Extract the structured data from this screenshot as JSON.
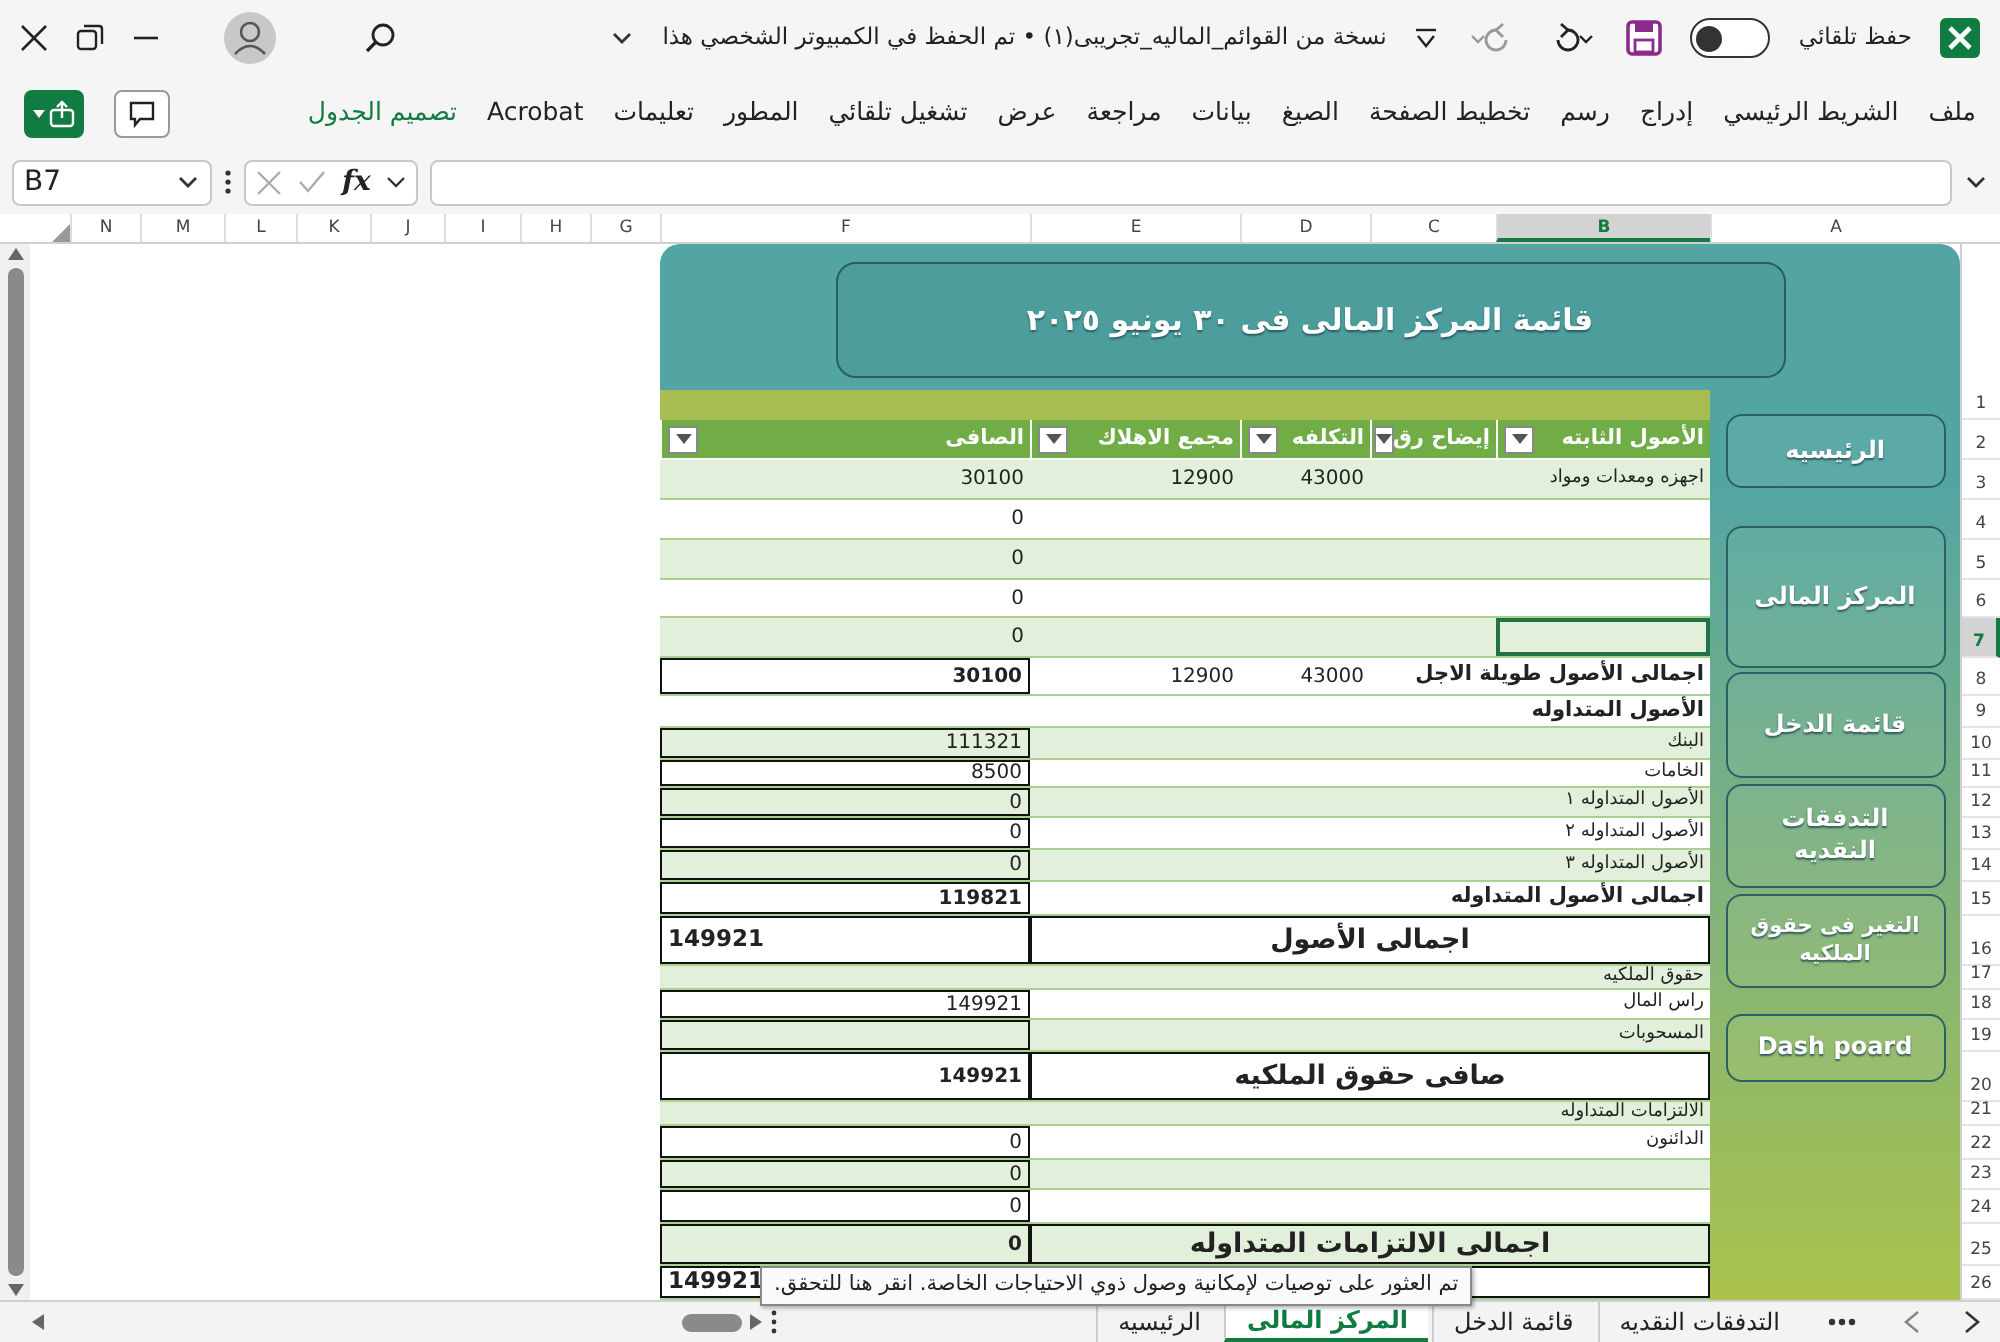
{
  "title_bar": {
    "autosave_label": "حفظ تلقائي",
    "autosave_on": false,
    "document_title": "نسخة من القوائم_الماليه_تجريبى(١) • تم الحفظ في الكمبيوتر الشخصي هذا"
  },
  "ribbon_tabs": [
    {
      "label": "ملف",
      "kind": "tab"
    },
    {
      "label": "الشريط الرئيسي",
      "kind": "tab"
    },
    {
      "label": "إدراج",
      "kind": "tab"
    },
    {
      "label": "رسم",
      "kind": "tab"
    },
    {
      "label": "تخطيط الصفحة",
      "kind": "tab"
    },
    {
      "label": "الصيغ",
      "kind": "tab"
    },
    {
      "label": "بيانات",
      "kind": "tab"
    },
    {
      "label": "مراجعة",
      "kind": "tab"
    },
    {
      "label": "عرض",
      "kind": "tab"
    },
    {
      "label": "تشغيل تلقائي",
      "kind": "tab"
    },
    {
      "label": "المطور",
      "kind": "tab"
    },
    {
      "label": "تعليمات",
      "kind": "tab"
    },
    {
      "label": "Acrobat",
      "kind": "tab"
    },
    {
      "label": "تصميم الجدول",
      "kind": "contextual"
    }
  ],
  "formula_bar": {
    "name_box": "B7",
    "function_label": "fx"
  },
  "column_headers": [
    {
      "label": "A",
      "selected": false
    },
    {
      "label": "B",
      "selected": true
    },
    {
      "label": "C",
      "selected": false
    },
    {
      "label": "D",
      "selected": false
    },
    {
      "label": "E",
      "selected": false
    },
    {
      "label": "F",
      "selected": false
    },
    {
      "label": "G",
      "selected": false
    },
    {
      "label": "H",
      "selected": false
    },
    {
      "label": "I",
      "selected": false
    },
    {
      "label": "J",
      "selected": false
    },
    {
      "label": "K",
      "selected": false
    },
    {
      "label": "L",
      "selected": false
    },
    {
      "label": "M",
      "selected": false
    },
    {
      "label": "N",
      "selected": false
    }
  ],
  "row_headers": [
    {
      "label": "1",
      "selected": false
    },
    {
      "label": "2",
      "selected": false
    },
    {
      "label": "3",
      "selected": false
    },
    {
      "label": "4",
      "selected": false
    },
    {
      "label": "5",
      "selected": false
    },
    {
      "label": "6",
      "selected": false
    },
    {
      "label": "7",
      "selected": true
    },
    {
      "label": "8",
      "selected": false
    },
    {
      "label": "9",
      "selected": false
    },
    {
      "label": "10",
      "selected": false
    },
    {
      "label": "11",
      "selected": false
    },
    {
      "label": "12",
      "selected": false
    },
    {
      "label": "13",
      "selected": false
    },
    {
      "label": "14",
      "selected": false
    },
    {
      "label": "15",
      "selected": false
    },
    {
      "label": "16",
      "selected": false
    },
    {
      "label": "17",
      "selected": false
    },
    {
      "label": "18",
      "selected": false
    },
    {
      "label": "19",
      "selected": false
    },
    {
      "label": "20",
      "selected": false
    },
    {
      "label": "21",
      "selected": false
    },
    {
      "label": "22",
      "selected": false
    },
    {
      "label": "23",
      "selected": false
    },
    {
      "label": "24",
      "selected": false
    },
    {
      "label": "25",
      "selected": false
    },
    {
      "label": "26",
      "selected": false
    }
  ],
  "sheet": {
    "title": "قائمة المركز المالى فى ٣٠ يونيو ٢٠٢٥",
    "table": {
      "columns": [
        "الأصول الثابته",
        "إيضاح رق",
        "التكلفه",
        "مجمع الاهلاك",
        "الصافى"
      ],
      "rows": [
        {
          "kind": "item",
          "label": "اجهزه ومعدات ومواد",
          "cost": "43000",
          "depreciation": "12900",
          "net": "30100",
          "shaded": true,
          "boxed": false,
          "selected": false
        },
        {
          "kind": "item",
          "net": "0",
          "shaded": false,
          "boxed": false,
          "selected": false
        },
        {
          "kind": "item",
          "net": "0",
          "shaded": true,
          "boxed": false,
          "selected": false
        },
        {
          "kind": "item",
          "net": "0",
          "shaded": false,
          "boxed": false,
          "selected": false
        },
        {
          "kind": "item",
          "net": "0",
          "shaded": true,
          "boxed": false,
          "selected": true
        },
        {
          "kind": "total",
          "label": "اجمالى الأصول طويلة الاجل",
          "cost": "43000",
          "depreciation": "12900",
          "net": "30100",
          "shaded": false,
          "boxed": true,
          "selected": false
        },
        {
          "kind": "section",
          "label": "الأصول المتداوله",
          "shaded": false,
          "boxed": false,
          "selected": false
        },
        {
          "kind": "item",
          "label": "البنك",
          "net": "111321",
          "shaded": true,
          "boxed": true,
          "selected": false
        },
        {
          "kind": "item",
          "label": "الخامات",
          "net": "8500",
          "shaded": false,
          "boxed": true,
          "selected": false
        },
        {
          "kind": "item",
          "label": "الأصول المتداوله ١",
          "net": "0",
          "shaded": true,
          "boxed": true,
          "selected": false
        },
        {
          "kind": "item",
          "label": "الأصول المتداوله ٢",
          "net": "0",
          "shaded": false,
          "boxed": true,
          "selected": false
        },
        {
          "kind": "item",
          "label": "الأصول المتداوله ٣",
          "net": "0",
          "shaded": true,
          "boxed": true,
          "selected": false
        },
        {
          "kind": "total",
          "label": "اجمالى الأصول المتداوله",
          "net": "119821",
          "shaded": false,
          "boxed": true,
          "selected": false
        },
        {
          "kind": "grand_total",
          "label": "اجمالى الأصول",
          "net": "149921",
          "shaded": false,
          "boxed": true,
          "selected": false
        },
        {
          "kind": "item",
          "label": "حقوق الملكيه",
          "shaded": true,
          "boxed": false,
          "selected": false
        },
        {
          "kind": "item",
          "label": "راس المال",
          "net": "149921",
          "shaded": false,
          "boxed": true,
          "selected": false
        },
        {
          "kind": "item",
          "label": "المسحوبات",
          "shaded": true,
          "boxed": true,
          "selected": false
        },
        {
          "kind": "headline_total",
          "label": "صافى حقوق الملكيه",
          "net": "149921",
          "shaded": false,
          "boxed": true,
          "selected": false
        },
        {
          "kind": "item",
          "label": "الالتزامات المتداوله",
          "shaded": true,
          "boxed": false,
          "selected": false
        },
        {
          "kind": "item",
          "label": "الدائنون",
          "net": "0",
          "shaded": false,
          "boxed": true,
          "selected": false
        },
        {
          "kind": "item",
          "net": "0",
          "shaded": true,
          "boxed": true,
          "selected": false
        },
        {
          "kind": "item",
          "net": "0",
          "shaded": false,
          "boxed": true,
          "selected": false
        },
        {
          "kind": "headline_total",
          "label": "اجمالى الالتزامات المتداوله",
          "net": "0",
          "shaded": true,
          "boxed": true,
          "selected": false
        },
        {
          "kind": "grand_total",
          "net": "149921",
          "shaded": false,
          "boxed": true,
          "selected": false
        }
      ]
    },
    "nav_buttons": [
      "الرئيسيه",
      "المركز المالى",
      "قائمة الدخل",
      "التدفقات النقديه",
      "التغير فى حقوق الملكيه",
      "Dash poard"
    ]
  },
  "sheet_tabs": [
    {
      "label": "التدفقات النقديه",
      "selected": false
    },
    {
      "label": "قائمة الدخل",
      "selected": false
    },
    {
      "label": "المركز المالى",
      "selected": true
    },
    {
      "label": "الرئيسيه",
      "selected": false
    }
  ],
  "tooltip": "تم العثور على توصيات لإمكانية وصول ذوي الاحتياجات الخاصة. انقر هنا للتحقق."
}
